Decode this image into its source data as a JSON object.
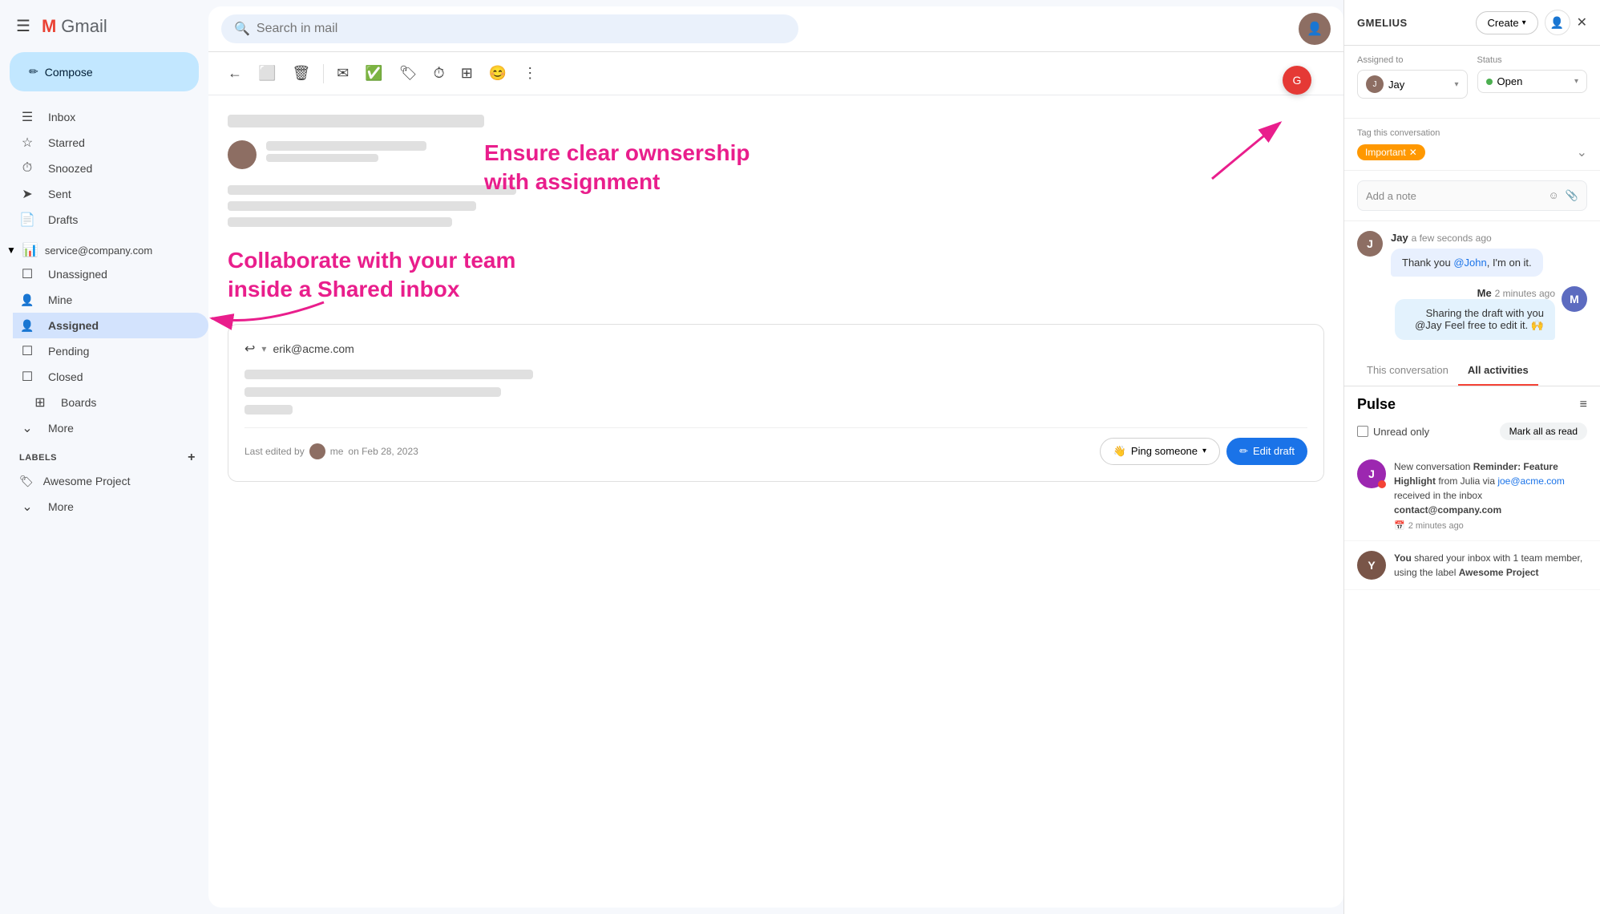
{
  "gmail": {
    "logo": "Gmail",
    "compose_label": "Compose",
    "search_placeholder": "Search in mail",
    "nav": {
      "inbox": "Inbox",
      "starred": "Starred",
      "snoozed": "Snoozed",
      "sent": "Sent",
      "drafts": "Drafts"
    },
    "shared_inbox": {
      "email": "service@company.com",
      "items": [
        {
          "label": "Unassigned",
          "icon": "☐"
        },
        {
          "label": "Mine",
          "icon": "👤"
        },
        {
          "label": "Assigned",
          "icon": "👤"
        },
        {
          "label": "Pending",
          "icon": "☐"
        },
        {
          "label": "Closed",
          "icon": "☐"
        }
      ]
    },
    "boards_label": "Boards",
    "more_labels": [
      "More",
      "More"
    ],
    "labels_section": "LABELS",
    "add_label": "+",
    "awesome_project": "Awesome Project"
  },
  "toolbar": {
    "back": "←",
    "archive": "⬜",
    "delete": "🗑",
    "mark": "✉",
    "snooze": "⊙",
    "clock": "⏱",
    "tasks": "⊞",
    "more_label": "⋮"
  },
  "annotations": {
    "top": "Ensure clear ownsership\nwith assignment",
    "bottom": "Collaborate with your team\ninside a Shared inbox"
  },
  "draft": {
    "to": "erik@acme.com",
    "last_edited": "Last edited by",
    "me": "me",
    "date": "on Feb 28, 2023",
    "ping_label": "Ping someone",
    "edit_label": "Edit draft"
  },
  "gmelius": {
    "title": "GMELIUS",
    "create_label": "Create",
    "close_icon": "✕",
    "assigned_to_label": "Assigned to",
    "assignee": "Jay",
    "status_label": "Status",
    "status_value": "Open",
    "tag_label": "Tag this conversation",
    "tag_name": "Important",
    "note_placeholder": "Add a note",
    "tabs": {
      "this_conversation": "This conversation",
      "all_activities": "All activities"
    },
    "pulse_title": "Pulse",
    "unread_only": "Unread only",
    "mark_all_read": "Mark all as read",
    "activities": [
      {
        "type": "notification",
        "title": "New conversation",
        "bold": "Reminder: Feature Highlight",
        "suffix": "from Julia via",
        "link": "joe@acme.com",
        "middle": "received in the inbox",
        "inbox": "contact@company.com",
        "time": "2 minutes ago",
        "avatar_color": "purple"
      },
      {
        "type": "share",
        "text": "You shared your inbox with 1 team member, using the label",
        "label": "Awesome Project",
        "time": "",
        "avatar_color": "brown"
      }
    ],
    "messages": [
      {
        "sender": "Jay",
        "time": "a few seconds ago",
        "text": "Thank you @John, I'm on it.",
        "mention": "@John",
        "avatar": "J"
      },
      {
        "sender": "Me",
        "time": "2 minutes ago",
        "text": "Sharing the draft with you @Jay Feel free to edit it. 🙌",
        "side": "right"
      }
    ]
  }
}
